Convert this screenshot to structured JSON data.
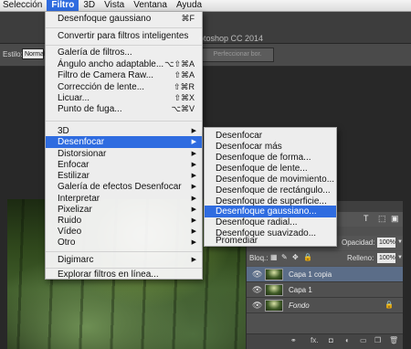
{
  "menubar": {
    "items": [
      "Selección",
      "Filtro",
      "3D",
      "Vista",
      "Ventana",
      "Ayuda"
    ],
    "active_index": 1
  },
  "app": {
    "title": "otoshop CC 2014",
    "options": {
      "estilo_label": "Estilo:",
      "estilo_value": "Normal",
      "perfeccionar_label": "Perfeccionar bor."
    }
  },
  "filter_menu": {
    "items": [
      {
        "label": "Desenfoque gaussiano",
        "shortcut": "⌘F"
      },
      {
        "label": "Convertir para filtros inteligentes"
      },
      {
        "label": "Galería de filtros..."
      },
      {
        "label": "Ángulo ancho adaptable...",
        "shortcut": "⌥⇧⌘A"
      },
      {
        "label": "Filtro de Camera Raw...",
        "shortcut": "⇧⌘A"
      },
      {
        "label": "Corrección de lente...",
        "shortcut": "⇧⌘R"
      },
      {
        "label": "Licuar...",
        "shortcut": "⇧⌘X"
      },
      {
        "label": "Punto de fuga...",
        "shortcut": "⌥⌘V"
      },
      {
        "label": "3D"
      },
      {
        "label": "Desenfocar"
      },
      {
        "label": "Distorsionar"
      },
      {
        "label": "Enfocar"
      },
      {
        "label": "Estilizar"
      },
      {
        "label": "Galería de efectos Desenfocar"
      },
      {
        "label": "Interpretar"
      },
      {
        "label": "Pixelizar"
      },
      {
        "label": "Ruido"
      },
      {
        "label": "Vídeo"
      },
      {
        "label": "Otro"
      },
      {
        "label": "Digimarc"
      },
      {
        "label": "Explorar filtros en línea..."
      }
    ],
    "arrow_glyph": "▶",
    "highlighted": "Desenfocar"
  },
  "blur_submenu": {
    "items": [
      "Desenfocar",
      "Desenfocar más",
      "Desenfoque de forma...",
      "Desenfoque de lente...",
      "Desenfoque de movimiento...",
      "Desenfoque de rectángulo...",
      "Desenfoque de superficie...",
      "Desenfoque gaussiano...",
      "Desenfoque radial...",
      "Desenfoque suavizado...",
      "Promediar"
    ],
    "highlighted": "Desenfoque gaussiano..."
  },
  "layers_panel": {
    "kind_icons": [
      "T",
      "⬚",
      "▣"
    ],
    "blend_label": "Opacidad:",
    "opacity": "100%",
    "lock_label": "Bloq.:",
    "fill_label": "Relleno:",
    "fill": "100%",
    "layers": [
      {
        "name": "Capa 1 copia",
        "selected": true
      },
      {
        "name": "Capa 1",
        "selected": false
      },
      {
        "name": "Fondo",
        "selected": false,
        "locked": true
      }
    ],
    "footer_icons": [
      "link-icon",
      "fx-icon",
      "mask-icon",
      "adjustment-icon",
      "folder-icon",
      "new-layer-icon",
      "trash-icon"
    ]
  },
  "colors": {
    "menu_highlight": "#2f6ce0",
    "layer_selected": "#5b6d88"
  }
}
